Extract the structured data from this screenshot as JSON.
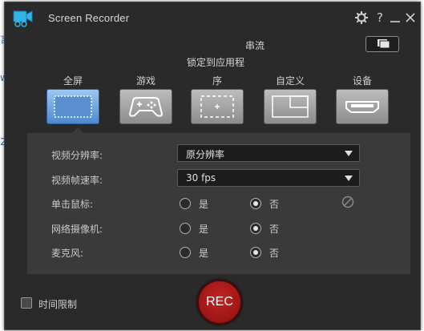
{
  "window": {
    "title": "Screen Recorder"
  },
  "header": {
    "stream_label": "串流",
    "lock_label_line1": "锁定到应用程",
    "lock_label_line2": "序"
  },
  "capture_modes": [
    {
      "label": "全屏",
      "icon": "fullscreen-icon",
      "active": true
    },
    {
      "label": "游戏",
      "icon": "gamepad-icon",
      "active": false
    },
    {
      "label": "序",
      "icon": "lock-app-icon",
      "active": false
    },
    {
      "label": "自定义",
      "icon": "custom-region-icon",
      "active": false
    },
    {
      "label": "设备",
      "icon": "hdmi-device-icon",
      "active": false
    }
  ],
  "settings": {
    "resolution": {
      "label": "视频分辨率:",
      "value": "原分辨率"
    },
    "framerate": {
      "label": "视频帧速率:",
      "value": "30 fps"
    },
    "mouse_click": {
      "label": "单击鼠标:",
      "yes": "是",
      "no": "否",
      "selected": "no"
    },
    "webcam": {
      "label": "网络摄像机:",
      "yes": "是",
      "no": "否",
      "selected": "no"
    },
    "microphone": {
      "label": "麦克风:",
      "yes": "是",
      "no": "否",
      "selected": "no"
    }
  },
  "footer": {
    "time_limit_label": "时间限制",
    "rec_label": "REC"
  },
  "colors": {
    "window_bg": "#2a2a2a",
    "panel_bg": "#3a3a3a",
    "active_mode": "#4c8ad0",
    "rec": "#b01818"
  }
}
